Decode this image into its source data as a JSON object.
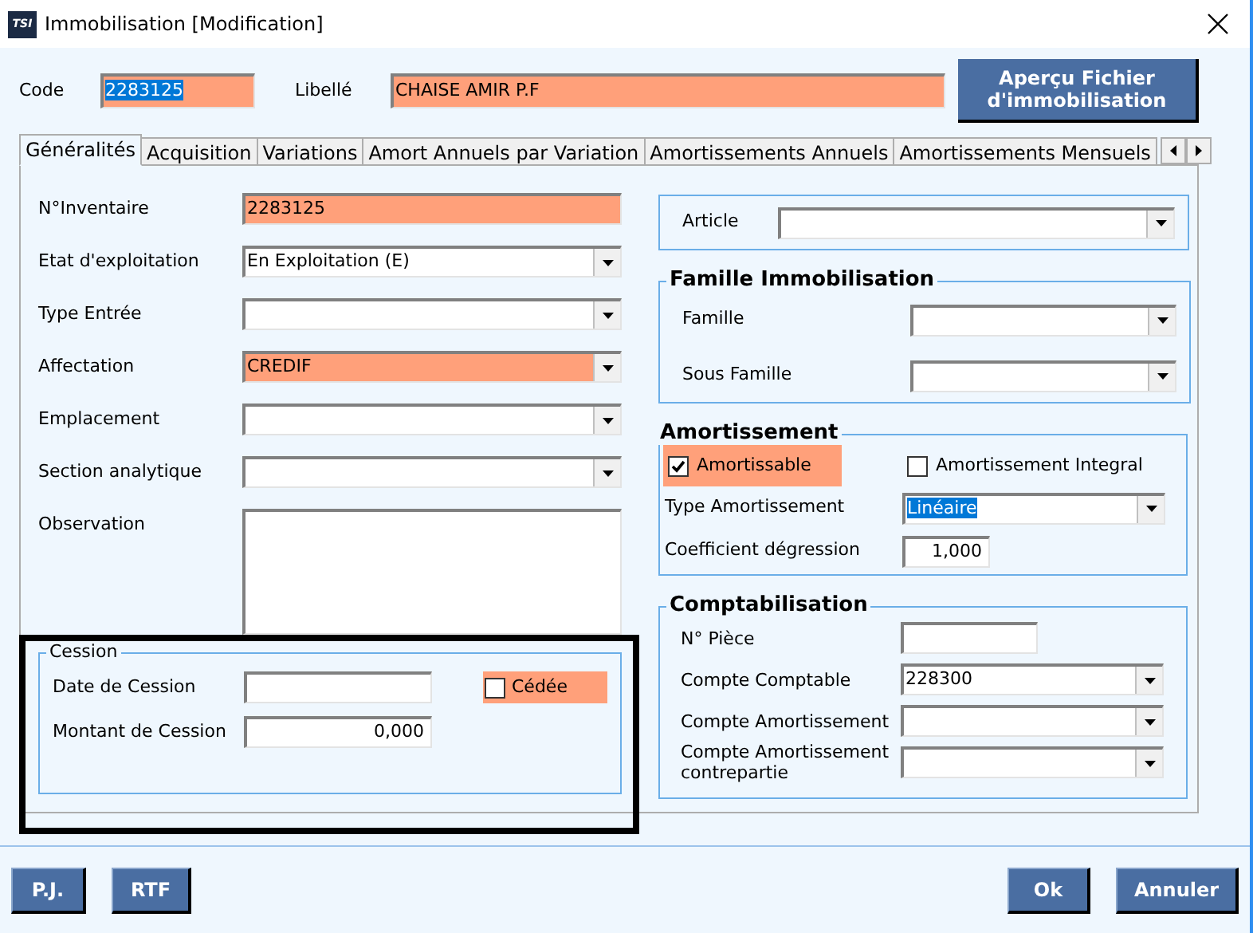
{
  "window": {
    "icon_label": "TSI",
    "title": "Immobilisation [Modification]"
  },
  "header": {
    "code": {
      "label": "Code",
      "value": "2283125",
      "text_selected": true,
      "highlighted": true
    },
    "libelle": {
      "label": "Libellé",
      "value": "CHAISE AMIR P.F",
      "highlighted": true
    },
    "preview_button": "Aperçu Fichier d'immobilisation"
  },
  "tabs": [
    {
      "label": "Généralités",
      "selected": true
    },
    {
      "label": "Acquisition",
      "selected": false
    },
    {
      "label": "Variations",
      "selected": false
    },
    {
      "label": "Amort Annuels par Variation",
      "selected": false
    },
    {
      "label": "Amortissements Annuels",
      "selected": false
    },
    {
      "label": "Amortissements Mensuels",
      "selected": false
    }
  ],
  "general_fields": [
    {
      "label": "N°Inventaire",
      "value": "2283125",
      "kind": "text",
      "highlighted": true
    },
    {
      "label": "Etat d'exploitation",
      "value": "En Exploitation (E)",
      "kind": "select",
      "highlighted": false
    },
    {
      "label": "Type Entrée",
      "kind": "select",
      "highlighted": false
    },
    {
      "label": "Affectation",
      "value": "CREDIF",
      "kind": "select",
      "highlighted": true
    },
    {
      "label": "Emplacement",
      "kind": "select",
      "highlighted": false
    },
    {
      "label": "Section analytique",
      "kind": "select",
      "highlighted": false
    },
    {
      "label": "Observation",
      "kind": "textarea",
      "highlighted": false
    }
  ],
  "cession": {
    "title": "Cession",
    "date_label": "Date de Cession",
    "ceded": {
      "label": "Cédée",
      "checked": false,
      "highlighted": true
    },
    "amount_label": "Montant de Cession",
    "amount": "0,000"
  },
  "article": {
    "label": "Article"
  },
  "famille_group": {
    "title": "Famille Immobilisation",
    "fields": [
      {
        "label": "Famille",
        "kind": "select"
      },
      {
        "label": "Sous Famille",
        "kind": "select"
      }
    ]
  },
  "amortissement": {
    "title": "Amortissement",
    "checkboxes": [
      {
        "label": "Amortissable",
        "checked": true,
        "highlighted": true
      },
      {
        "label": "Amortissement Integral",
        "checked": false,
        "highlighted": false
      }
    ],
    "fields": [
      {
        "label": "Type Amortissement",
        "value": "Linéaire",
        "kind": "select",
        "text_selected": true
      },
      {
        "label": "Coefficient dégression",
        "value": "1,000",
        "kind": "number",
        "text_selected": false
      }
    ]
  },
  "comptabilisation": {
    "title": "Comptabilisation",
    "fields": [
      {
        "label": "N° Pièce",
        "kind": "short"
      },
      {
        "label": "Compte Comptable",
        "value": "228300",
        "kind": "select"
      },
      {
        "label": "Compte Amortissement",
        "kind": "select"
      },
      {
        "label": "Compte Amortissement contrepartie",
        "kind": "select"
      }
    ]
  },
  "footer": {
    "left_buttons": [
      "P.J.",
      "RTF"
    ],
    "right_buttons": [
      "Ok",
      "Annuler"
    ]
  }
}
